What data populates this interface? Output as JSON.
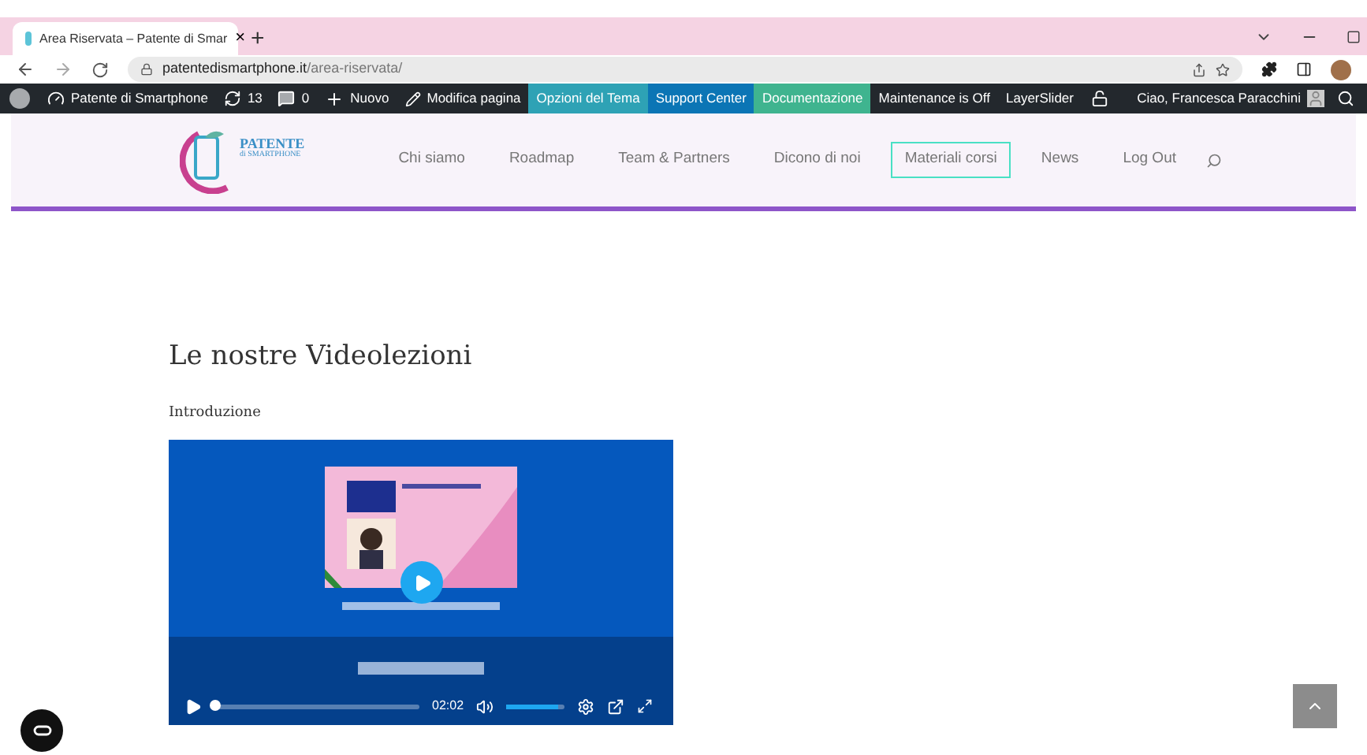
{
  "browser": {
    "tab": {
      "title": "Area Riservata – Patente di Smar",
      "close": "×"
    },
    "new_tab": "+",
    "url": {
      "domain": "patentedismartphone.it",
      "path": "/area-riservata/"
    }
  },
  "admin_bar": {
    "items": [
      {
        "kind": "icon"
      },
      {
        "kind": "site",
        "label": "Patente di Smartphone"
      },
      {
        "kind": "updates",
        "label": "13"
      },
      {
        "kind": "comments",
        "label": "0"
      },
      {
        "kind": "new",
        "label": "Nuovo"
      },
      {
        "kind": "edit",
        "label": "Modifica pagina"
      },
      {
        "kind": "teal",
        "label": "Opzioni del Tema"
      },
      {
        "kind": "blue",
        "label": "Support Center"
      },
      {
        "kind": "green",
        "label": "Documentazione"
      },
      {
        "kind": "plain",
        "label": "Maintenance is Off"
      },
      {
        "kind": "plain",
        "label": "LayerSlider"
      },
      {
        "kind": "lock"
      }
    ],
    "user": "Ciao, Francesca Paracchini"
  },
  "logo": {
    "line1": "PATENTE",
    "line2": "di SMARTPHONE"
  },
  "nav": [
    {
      "label": "Chi siamo",
      "selected": false
    },
    {
      "label": "Roadmap",
      "selected": false
    },
    {
      "label": "Team & Partners",
      "selected": false
    },
    {
      "label": "Dicono di noi",
      "selected": false
    },
    {
      "label": "Materiali corsi",
      "selected": true
    },
    {
      "label": "News",
      "selected": false
    },
    {
      "label": "Log Out",
      "selected": false
    }
  ],
  "page": {
    "title": "Le nostre Videolezioni",
    "section": "Introduzione"
  },
  "video": {
    "kind": "picture",
    "progress": {
      "level": 0.0
    },
    "time": "02:02",
    "volume": {
      "level": 0.9
    }
  }
}
